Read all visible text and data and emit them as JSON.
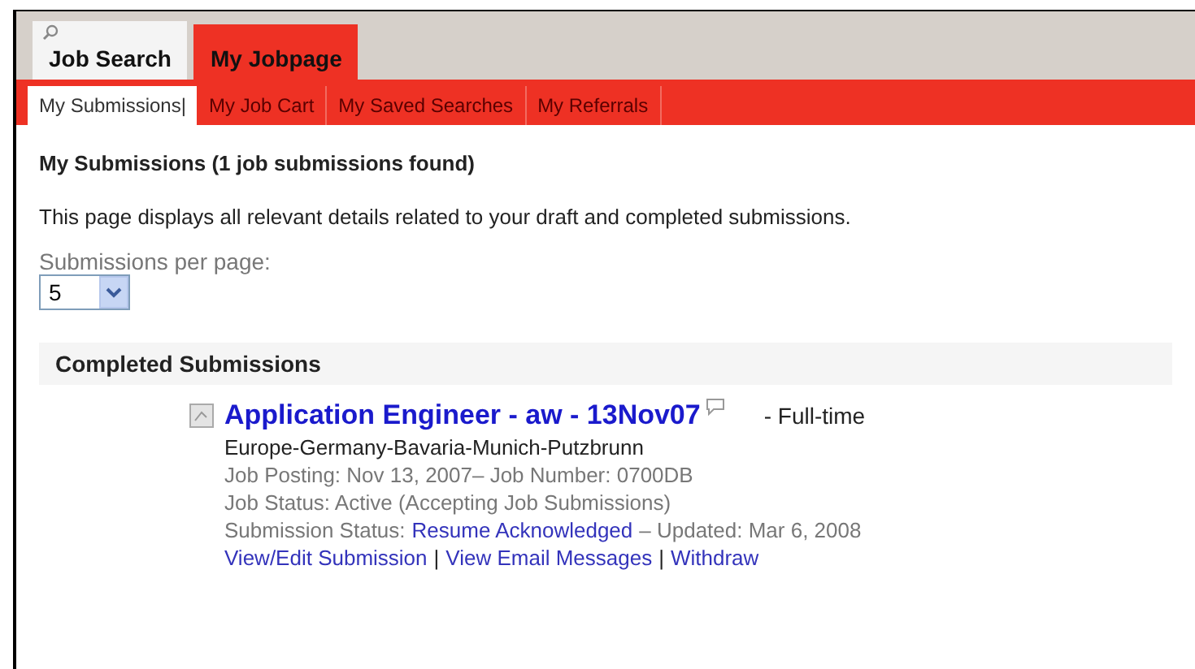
{
  "main_tabs": [
    {
      "label": "Job Search",
      "selected": false
    },
    {
      "label": "My Jobpage",
      "selected": true
    }
  ],
  "sub_tabs": [
    {
      "label": "My Submissions|",
      "selected": true
    },
    {
      "label": "My Job Cart",
      "selected": false
    },
    {
      "label": "My Saved Searches",
      "selected": false
    },
    {
      "label": "My Referrals",
      "selected": false
    }
  ],
  "heading": "My Submissions (1 job submissions found)",
  "description": "This page displays all relevant details related to your draft and completed submissions.",
  "per_page": {
    "label": "Submissions per page:",
    "value": "5"
  },
  "section": {
    "title": "Completed Submissions"
  },
  "submission": {
    "title": "Application Engineer - aw - 13Nov07",
    "type": "-  Full-time",
    "location": "Europe-Germany-Bavaria-Munich-Putzbrunn",
    "posting": "Job Posting: Nov 13, 2007– Job Number: 0700DB",
    "job_status": "Job Status: Active (Accepting Job Submissions)",
    "status_label": "Submission Status:",
    "status_link": "Resume Acknowledged",
    "updated": "– Updated: Mar 6, 2008",
    "actions": [
      "View/Edit Submission",
      "View Email Messages",
      "Withdraw"
    ],
    "separator": "|"
  }
}
